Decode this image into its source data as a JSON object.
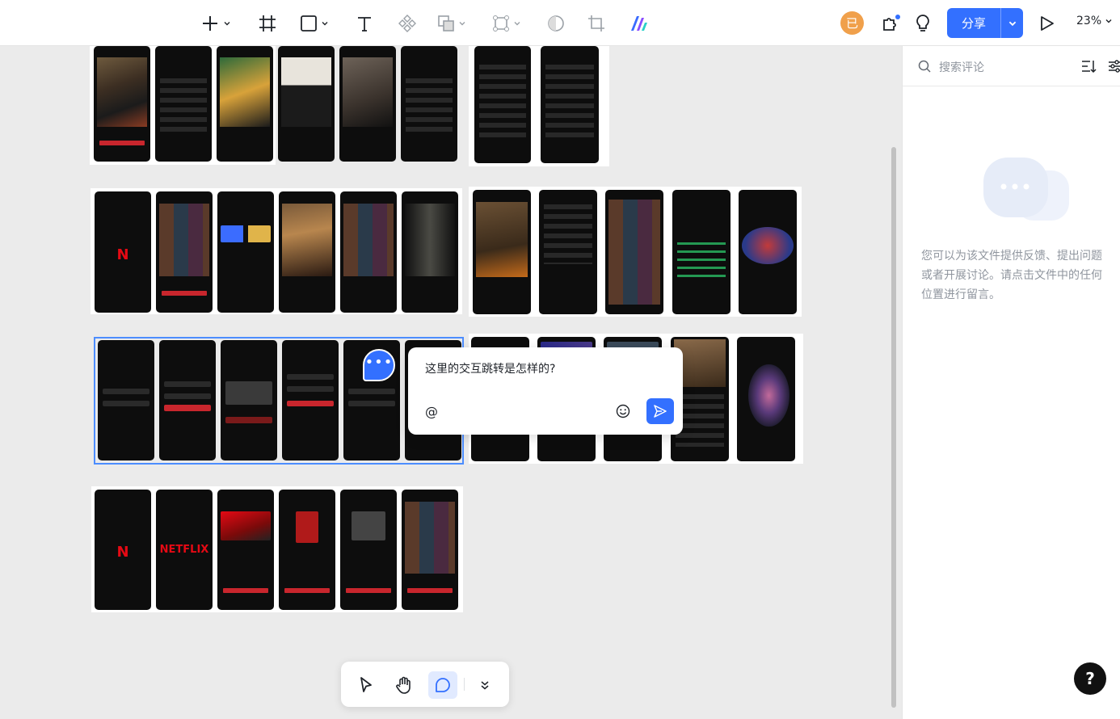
{
  "toolbar": {
    "tools": [
      {
        "name": "add",
        "icon": "plus-icon"
      },
      {
        "name": "frame",
        "icon": "frame-icon"
      },
      {
        "name": "shape",
        "icon": "rectangle-icon"
      },
      {
        "name": "text",
        "icon": "text-icon"
      },
      {
        "name": "component",
        "icon": "component-icon"
      },
      {
        "name": "boolean",
        "icon": "boolean-icon"
      },
      {
        "name": "vector",
        "icon": "vector-icon"
      },
      {
        "name": "mask",
        "icon": "mask-icon"
      },
      {
        "name": "crop",
        "icon": "crop-icon"
      },
      {
        "name": "ai",
        "icon": "ai-logo-icon"
      }
    ],
    "avatar_initial": "已",
    "share_label": "分享",
    "zoom_label": "23%",
    "accent": "#3370ff"
  },
  "comment": {
    "text": "这里的交互跳转是怎样的?",
    "mention_symbol": "@"
  },
  "panel": {
    "search_placeholder": "搜索评论",
    "empty_message": "您可以为该文件提供反馈、提出问题或者开展讨论。请点击文件中的任何位置进行留言。"
  },
  "bottom_tools": [
    {
      "name": "select",
      "icon": "cursor-icon"
    },
    {
      "name": "hand",
      "icon": "hand-icon"
    },
    {
      "name": "comment",
      "icon": "comment-icon",
      "active": true
    },
    {
      "name": "more",
      "icon": "double-chevron-down-icon"
    }
  ],
  "help_label": "?",
  "screens": {
    "logo_n": "N",
    "logo_netflix": "NETFLIX"
  }
}
